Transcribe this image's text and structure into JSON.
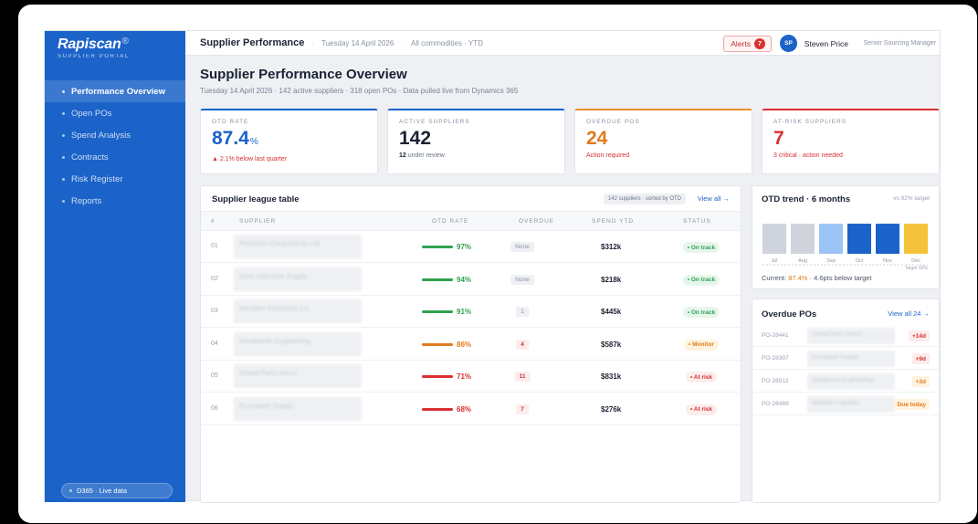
{
  "sidebar": {
    "brand": "Rapiscan",
    "brand_mark": "®",
    "brand_sub": "SUPPLIER PORTAL",
    "items": [
      {
        "label": "Performance Overview"
      },
      {
        "label": "Open POs"
      },
      {
        "label": "Spend Analysis"
      },
      {
        "label": "Contracts"
      },
      {
        "label": "Risk Register"
      },
      {
        "label": "Reports"
      }
    ],
    "live_label": "D365 · Live data"
  },
  "topbar": {
    "title": "Supplier Performance",
    "date": "Tuesday 14 April 2026",
    "scope": "All commodities · YTD",
    "alerts_label": "Alerts",
    "alerts_count": "7",
    "avatar_initials": "SP",
    "user_name": "Steven Price",
    "user_role": "Senior Sourcing Manager"
  },
  "page": {
    "title": "Supplier Performance Overview",
    "subtitle": "Tuesday 14 April 2026 · 142 active suppliers · 318 open POs · Data pulled live from Dynamics 365"
  },
  "kpis": [
    {
      "label": "OTD RATE",
      "value": "87.4",
      "unit": "%",
      "note": "▲ 2.1% below last quarter",
      "accent": "#1b63c8",
      "value_color": "#1b63c8",
      "note_color": "#d93030"
    },
    {
      "label": "ACTIVE SUPPLIERS",
      "value": "142",
      "unit": "",
      "note_strong": "12",
      "note": " under review",
      "accent": "#1b63c8",
      "value_color": "#1a2233",
      "note_color": "#6a7385"
    },
    {
      "label": "OVERDUE POS",
      "value": "24",
      "unit": "",
      "note": "Action required",
      "accent": "#e8902a",
      "value_color": "#e07b1a",
      "note_color": "#d93030"
    },
    {
      "label": "AT-RISK SUPPLIERS",
      "value": "7",
      "unit": "",
      "note": "3 critical · action needed",
      "accent": "#d93030",
      "value_color": "#d93030",
      "note_color": "#d93030"
    }
  ],
  "league": {
    "title": "Supplier league table",
    "pill": "142 suppliers · sorted by OTD",
    "view_all": "View all →",
    "columns": {
      "num": "#",
      "supplier": "SUPPLIER",
      "otd": "OTD RATE",
      "overdue": "OVERDUE",
      "spend": "SPEND YTD",
      "status": "STATUS"
    },
    "rows": [
      {
        "num": "01",
        "supplier": "Precision Components Ltd",
        "otd": "97%",
        "otd_color": "#2fa24f",
        "overdue": "None",
        "overdue_kind": "none",
        "spend": "$312k",
        "status": "• On track",
        "status_kind": "ok"
      },
      {
        "num": "02",
        "supplier": "Atlas Industrial Supply",
        "otd": "94%",
        "otd_color": "#2fa24f",
        "overdue": "None",
        "overdue_kind": "none",
        "spend": "$218k",
        "status": "• On track",
        "status_kind": "ok"
      },
      {
        "num": "03",
        "supplier": "Meridian Fasteners Co.",
        "otd": "91%",
        "otd_color": "#2fa24f",
        "overdue": "1",
        "overdue_kind": "low",
        "spend": "$445k",
        "status": "• On track",
        "status_kind": "ok"
      },
      {
        "num": "04",
        "supplier": "Westbrook Engineering",
        "otd": "86%",
        "otd_color": "#e07b1a",
        "overdue": "4",
        "overdue_kind": "high",
        "spend": "$587k",
        "status": "• Monitor",
        "status_kind": "warn"
      },
      {
        "num": "05",
        "supplier": "Global Parts Direct",
        "otd": "71%",
        "otd_color": "#d93030",
        "overdue": "11",
        "overdue_kind": "high",
        "spend": "$831k",
        "status": "• At risk",
        "status_kind": "risk"
      },
      {
        "num": "06",
        "supplier": "Eurospark Supply",
        "otd": "68%",
        "otd_color": "#d93030",
        "overdue": "7",
        "overdue_kind": "high",
        "spend": "$276k",
        "status": "• At risk",
        "status_kind": "risk"
      }
    ]
  },
  "trend": {
    "title": "OTD trend · 6 months",
    "target_note": "vs 92% target",
    "target_label": "Target 92%",
    "current_prefix": "Current: ",
    "current_value": "87.4%",
    "current_suffix": " · 4.6pts below target"
  },
  "chart_data": {
    "type": "bar",
    "title": "OTD trend · 6 months",
    "categories": [
      "Jul",
      "Aug",
      "Sep",
      "Oct",
      "Nov",
      "Dec"
    ],
    "values": [
      88,
      88,
      88,
      88,
      88,
      88
    ],
    "target": 92,
    "colors": [
      "#cfd4dc",
      "#cfd4dc",
      "#9cc4f4",
      "#1b63c8",
      "#1b63c8",
      "#f5c23a"
    ],
    "grid": false
  },
  "overdue_pos": {
    "title": "Overdue POs",
    "view_all": "View all 24 →",
    "rows": [
      {
        "id": "PO-28441",
        "supplier": "Global Parts Direct",
        "badge": "+14d",
        "kind": "risk"
      },
      {
        "id": "PO-28397",
        "supplier": "Eurospark Supply",
        "badge": "+9d",
        "kind": "risk"
      },
      {
        "id": "PO-28512",
        "supplier": "Westbrook Engineering",
        "badge": "+3d",
        "kind": "warn"
      },
      {
        "id": "PO-28489",
        "supplier": "Meridian Logistics",
        "badge": "Due today",
        "kind": "warn"
      }
    ]
  }
}
